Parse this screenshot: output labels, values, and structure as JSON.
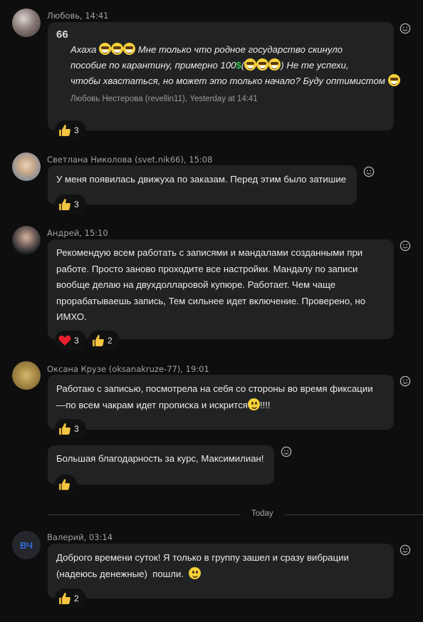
{
  "messages": [
    {
      "author": "Любовь, 14:41",
      "quote_mark": "66",
      "quote_lines": [
        "Ахаха",
        "Мне только что родное государство скинуло",
        "пособие по карантину, примерно 100",
        "(",
        ") Не те успехи,",
        "чтобы хвастаться, но может это только начало? Буду оптимистом"
      ],
      "quote_source": "Любовь Нестерова (revellin11), Yesterday at 14:41",
      "reactions": [
        {
          "icon": "thumbs-up-icon",
          "count": "3"
        }
      ]
    },
    {
      "author": "Светлана Николова (svet.nik66), 15:08",
      "text": [
        "У меня появилась движуха по заказам. Перед этим было затишие"
      ],
      "reactions": [
        {
          "icon": "thumbs-up-icon",
          "count": "3"
        }
      ]
    },
    {
      "author": "Андрей, 15:10",
      "text": [
        "Рекомендую всем работать с записями и мандалами созданными при",
        "работе. Просто заново проходите все настройки. Мандалу по записи",
        "вообще делаю на двухдолларовой купюре. Работает. Чем чаще",
        "прорабатываешь запись, Тем сильнее идет включение. Проверено, но",
        "ИМХО."
      ],
      "reactions": [
        {
          "icon": "heart-icon",
          "count": "3"
        },
        {
          "icon": "thumbs-up-icon",
          "count": "2"
        }
      ]
    },
    {
      "author": "Оксана Крузе (oksanakruze-77), 19:01",
      "text": [
        "Работаю с записью, посмотрела на себя со стороны во время фиксации",
        "—по всем чакрам идет прописка и искрится",
        "!!!!"
      ],
      "reactions": [
        {
          "icon": "thumbs-up-icon",
          "count": "3"
        }
      ]
    },
    {
      "text": [
        "Большая благодарность за курс, Максимилиан!"
      ],
      "reactions": [
        {
          "icon": "thumbs-up-icon",
          "count": ""
        }
      ]
    },
    {
      "author": "Валерий, 03:14",
      "avatar_initials": "ВЧ",
      "text": [
        "Доброго времени суток! Я только в группу зашел и сразу вибрации",
        "(надеюсь денежные)  пошли."
      ],
      "reactions": [
        {
          "icon": "thumbs-up-icon",
          "count": "2"
        }
      ]
    }
  ],
  "divider": {
    "label": "Today"
  },
  "colors": {
    "bubble": "#212223",
    "background": "#0e0e0e",
    "accent": "#2f6fd6"
  }
}
